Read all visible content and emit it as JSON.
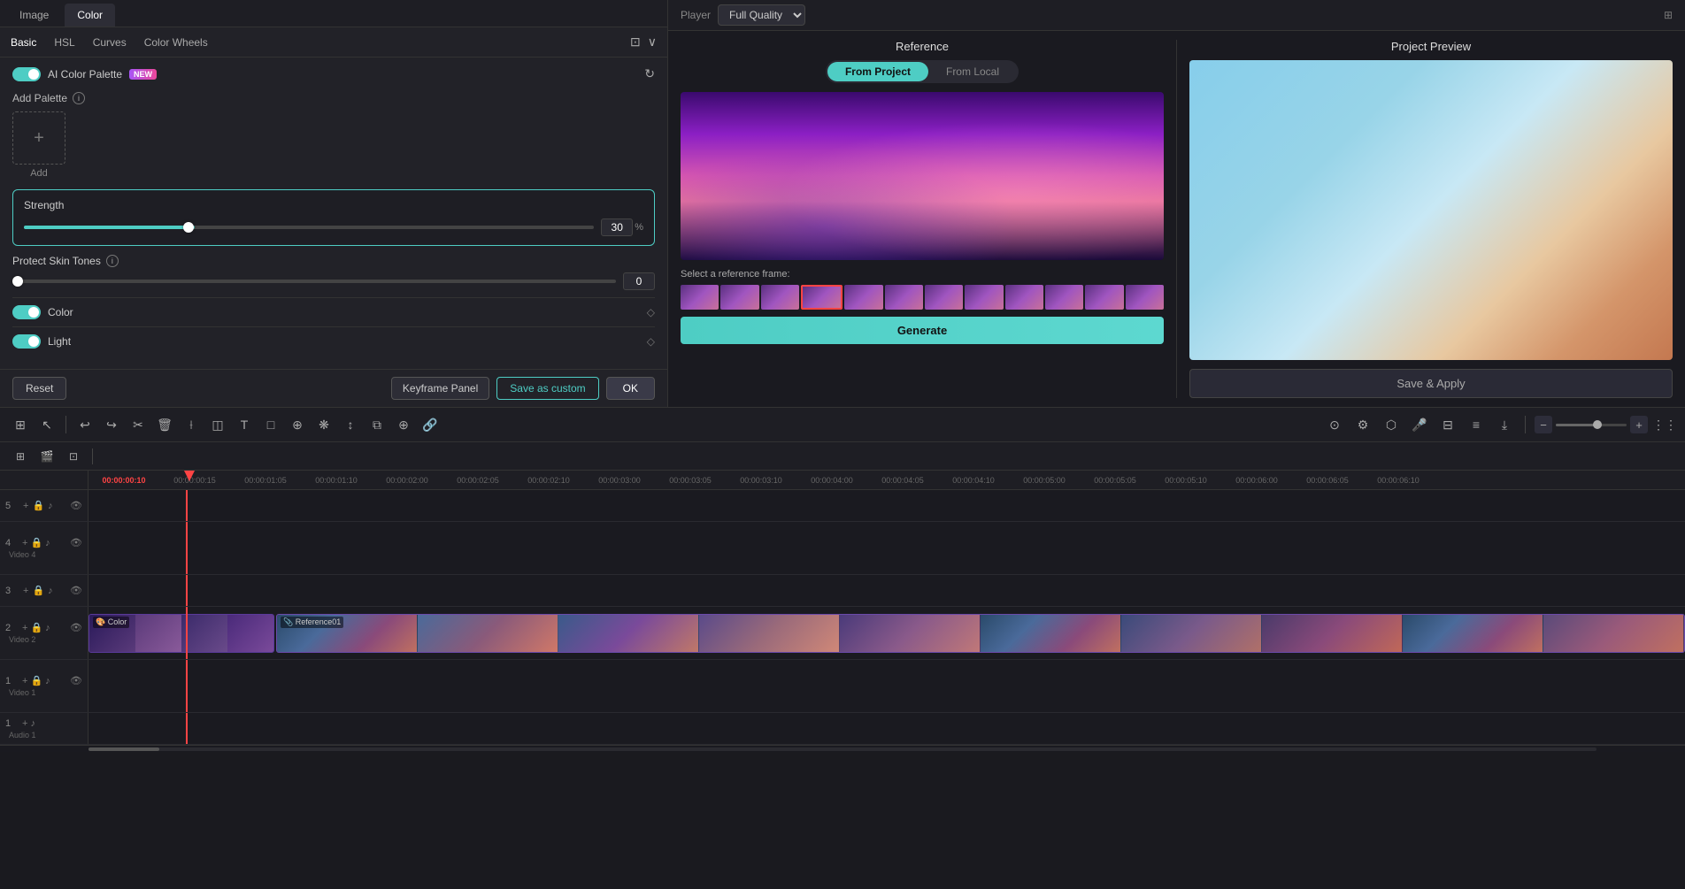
{
  "header": {
    "image_tab": "Image",
    "color_tab": "Color"
  },
  "left_panel": {
    "sub_tabs": [
      "Basic",
      "HSL",
      "Curves",
      "Color Wheels"
    ],
    "active_sub_tab": "Basic",
    "ai_toggle_label": "AI Color Palette",
    "badge": "NEW",
    "add_palette_label": "Add Palette",
    "add_btn_label": "Add",
    "strength_label": "Strength",
    "strength_value": "30",
    "strength_unit": "%",
    "protect_skin_label": "Protect Skin Tones",
    "protect_value": "0",
    "color_label": "Color",
    "light_label": "Light",
    "reset_btn": "Reset",
    "keyframe_btn": "Keyframe Panel",
    "save_custom_btn": "Save as custom",
    "ok_btn": "OK"
  },
  "player": {
    "player_label": "Player",
    "quality": "Full Quality"
  },
  "reference": {
    "title": "Reference",
    "from_project": "From Project",
    "from_local": "From Local",
    "select_frame_label": "Select a reference frame:",
    "generate_btn": "Generate"
  },
  "preview": {
    "title": "Project Preview",
    "save_apply_btn": "Save & Apply"
  },
  "toolbar": {
    "icons": [
      "⊞",
      "↖",
      "|",
      "↩",
      "↪",
      "✂",
      "🗑",
      "✂",
      "🖱",
      "T",
      "□",
      "⊕",
      "◈",
      "↕",
      "⧉",
      "⊕",
      "🔗"
    ]
  },
  "timeline": {
    "tracks": [
      {
        "num": "5",
        "name": ""
      },
      {
        "num": "4",
        "name": "Video 4"
      },
      {
        "num": "3",
        "name": ""
      },
      {
        "num": "2",
        "name": "Video 2"
      },
      {
        "num": "1",
        "name": "Video 1"
      },
      {
        "num": "1",
        "name": "Audio 1"
      }
    ],
    "ruler_marks": [
      "00:00:00:10",
      "00:00:00:15",
      "00:00:01:05",
      "00:00:01:10",
      "00:00:02:00",
      "00:00:02:05",
      "00:00:02:10",
      "00:00:03:00",
      "00:00:03:05",
      "00:00:03:10",
      "00:00:04:00",
      "00:00:04:05",
      "00:00:04:10",
      "00:00:05:00",
      "00:00:05:05",
      "00:00:05:10",
      "00:00:06:00",
      "00:00:06:05",
      "00:00:06:10"
    ],
    "color_clip_label": "Color",
    "reference_clip_label": "Reference01"
  }
}
